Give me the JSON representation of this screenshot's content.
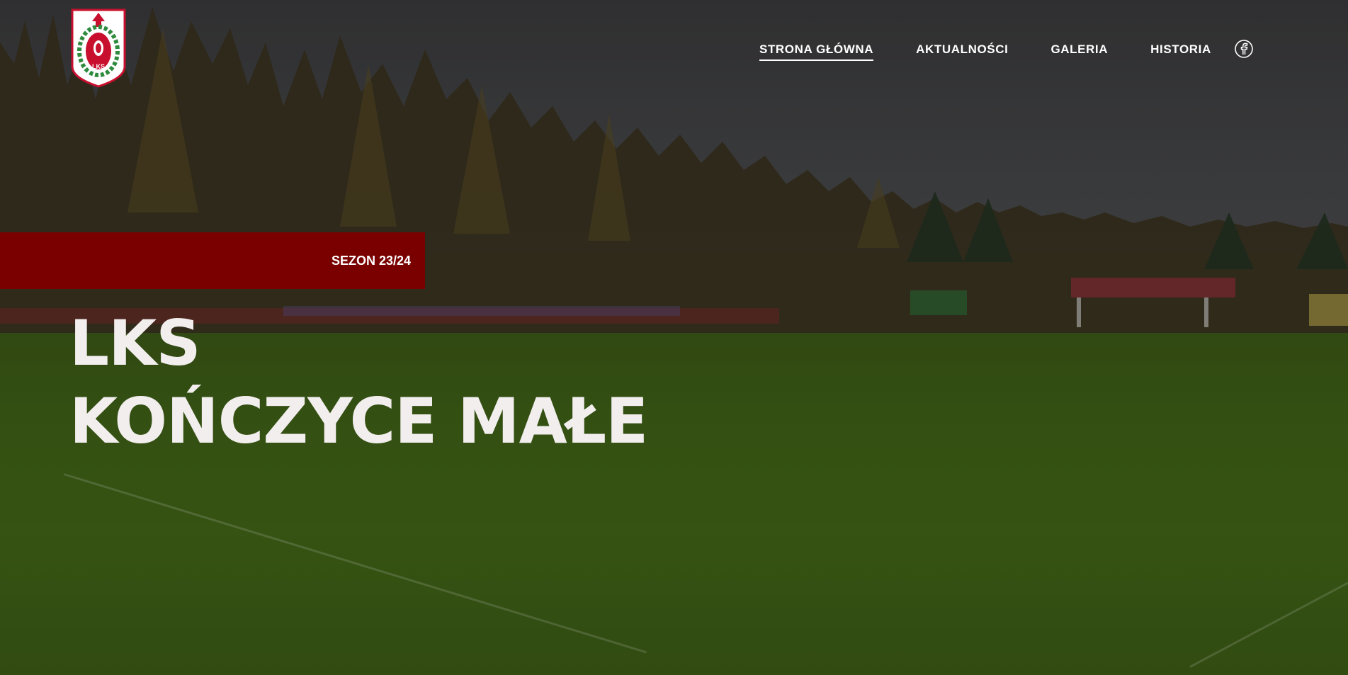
{
  "header": {
    "logo_icon": "club-crest-icon",
    "logo_text": "LKS",
    "nav": [
      {
        "label": "STRONA GŁÓWNA",
        "active": true
      },
      {
        "label": "AKTUALNOŚCI",
        "active": false
      },
      {
        "label": "GALERIA",
        "active": false
      },
      {
        "label": "HISTORIA",
        "active": false
      }
    ],
    "social_icon": "facebook-icon"
  },
  "hero": {
    "season_label": "SEZON 23/24",
    "title_line1": "LKS",
    "title_line2": "KOŃCZYCE MAŁE",
    "background": "stadium-field-photo"
  },
  "colors": {
    "accent": "#7a0000",
    "text": "#f3eeee",
    "crest_red": "#c8102e",
    "crest_green": "#2e8b3d"
  }
}
